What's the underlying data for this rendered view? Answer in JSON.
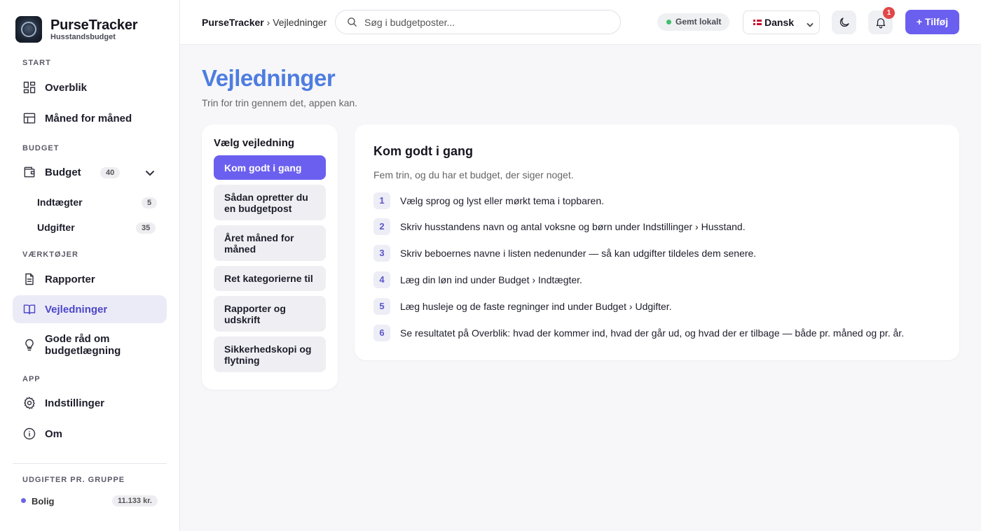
{
  "brand": {
    "title": "PurseTracker",
    "subtitle": "Husstandsbudget"
  },
  "sidebar": {
    "sections": {
      "start": "START",
      "budget": "BUDGET",
      "tools": "VÆRKTØJER",
      "app": "APP",
      "groups": "UDGIFTER PR. GRUPPE"
    },
    "items": {
      "overview": "Overblik",
      "monthly": "Måned for måned",
      "budget": "Budget",
      "budget_count": "40",
      "income": "Indtægter",
      "income_count": "5",
      "expenses": "Udgifter",
      "expenses_count": "35",
      "reports": "Rapporter",
      "guides": "Vejledninger",
      "tips": "Gode råd om budgetlægning",
      "settings": "Indstillinger",
      "about": "Om"
    },
    "groups": [
      {
        "name": "Bolig",
        "amount": "11.133 kr.",
        "color": "#6b63e6"
      }
    ]
  },
  "header": {
    "breadcrumb_root": "PurseTracker",
    "breadcrumb_sep": "›",
    "breadcrumb_current": "Vejledninger",
    "search_placeholder": "Søg i budgetposter...",
    "saved_status": "Gemt lokalt",
    "language": "Dansk",
    "notification_count": "1",
    "add_label": "+ Tilføj"
  },
  "main": {
    "title": "Vejledninger",
    "subtitle": "Trin for trin gennem det, appen kan.",
    "guide_list": {
      "heading": "Vælg vejledning",
      "items": [
        "Kom godt i gang",
        "Sådan opretter du en budgetpost",
        "Året måned for måned",
        "Ret kategorierne til",
        "Rapporter og udskrift",
        "Sikkerhedskopi og flytning"
      ],
      "active_index": 0
    },
    "guide": {
      "title": "Kom godt i gang",
      "intro": "Fem trin, og du har et budget, der siger noget.",
      "steps": [
        {
          "n": "1",
          "text": "Vælg sprog og lyst eller mørkt tema i topbaren."
        },
        {
          "n": "2",
          "text": "Skriv husstandens navn og antal voksne og børn under Indstillinger › Husstand."
        },
        {
          "n": "3",
          "text": "Skriv beboernes navne i listen nedenunder — så kan udgifter tildeles dem senere."
        },
        {
          "n": "4",
          "text": "Læg din løn ind under Budget › Indtægter."
        },
        {
          "n": "5",
          "text": "Læg husleje og de faste regninger ind under Budget › Udgifter."
        },
        {
          "n": "6",
          "text": "Se resultatet på Overblik: hvad der kommer ind, hvad der går ud, og hvad der er tilbage — både pr. måned og pr. år."
        }
      ]
    }
  },
  "colors": {
    "accent": "#6b5ff0",
    "title_blue": "#4d7de0",
    "active_nav": "#4d46c8",
    "saved_dot": "#3fbf6a",
    "notif": "#e04848"
  }
}
